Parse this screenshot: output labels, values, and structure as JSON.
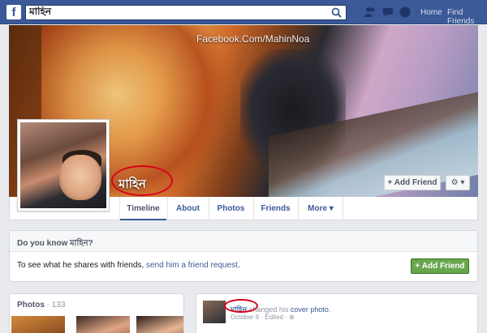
{
  "topbar": {
    "logo": "f",
    "search_value": "মাহিন",
    "nav": {
      "home": "Home",
      "find_friends": "Find Friends"
    }
  },
  "cover": {
    "watermark": "Facebook.Com/MahinNoa",
    "profile_name": "মাহিন",
    "add_friend": "Add Friend",
    "settings": "⚙ ▾"
  },
  "tabs": [
    {
      "label": "Timeline"
    },
    {
      "label": "About"
    },
    {
      "label": "Photos"
    },
    {
      "label": "Friends"
    },
    {
      "label": "More ▾"
    }
  ],
  "know": {
    "title": "Do you know মাহিন?",
    "text_prefix": "To see what he shares with friends,",
    "link": "send him a friend request",
    "text_suffix": ".",
    "add_friend": "Add Friend"
  },
  "photos": {
    "title": "Photos",
    "count": "· 133"
  },
  "story": {
    "name": "মাহিন",
    "action": "changed his",
    "link": "cover photo",
    "period": ".",
    "meta": "October 9 · Edited · ⊕"
  },
  "colors": {
    "brand": "#3b5998",
    "green_button": "#69a74e",
    "highlight_circle": "#d8001a"
  }
}
